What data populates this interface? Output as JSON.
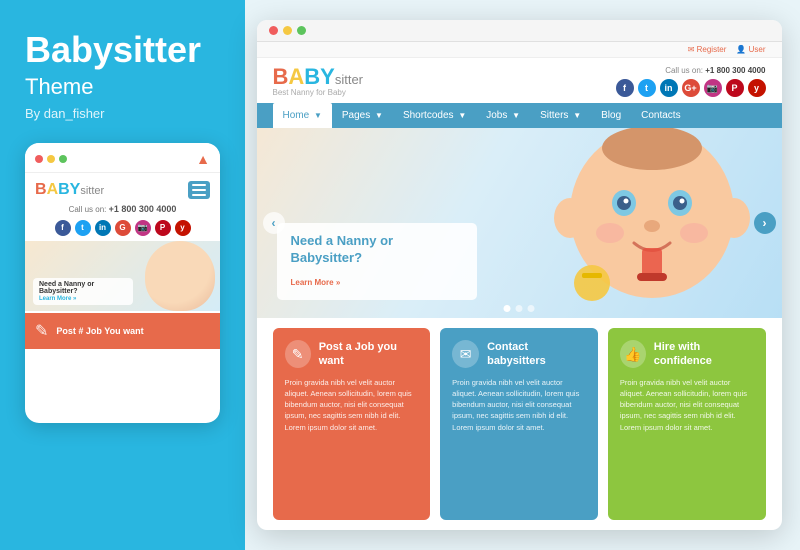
{
  "left": {
    "title": "Babysitter",
    "subtitle": "Theme",
    "author": "By dan_fisher",
    "mobile": {
      "logo_B": "B",
      "logo_A": "A",
      "logo_BY": "BY",
      "logo_sitter": "sitter",
      "callus_label": "Call us on:",
      "callus_number": "+1 800 300 4000",
      "hero_headline": "Need a Nanny or Babysitter?",
      "hero_learnmore": "Learn More »",
      "card_text": "Post # Job You want"
    }
  },
  "desktop": {
    "topbar_title": "···",
    "header_top_links": [
      "Register",
      "User"
    ],
    "logo_B": "B",
    "logo_A": "A",
    "logo_BY": "BY",
    "logo_sitter": "sitter",
    "logo_tagline": "Best Nanny for Baby",
    "callus_label": "Call us on:",
    "callus_number": "+1 800 300 4000",
    "nav_items": [
      "Home",
      "Pages",
      "Shortcodes",
      "Jobs",
      "Sitters",
      "Blog",
      "Contacts"
    ],
    "hero_headline": "Need a Nanny or Babysitter?",
    "hero_learnmore": "Learn More »",
    "feature_cards": [
      {
        "icon": "✎",
        "title": "Post a Job you want",
        "body": "Proin gravida nibh vel velit auctor aliquet. Aenean sollicitudin, lorem quis bibendum auctor, nisi elit consequat ipsum, nec sagittis sem nibh id elit. Lorem ipsum dolor sit amet."
      },
      {
        "icon": "✉",
        "title": "Contact babysitters",
        "body": "Proin gravida nibh vel velit auctor aliquet. Aenean sollicitudin, lorem quis bibendum auctor, nisi elit consequat ipsum, nec sagittis sem nibh id elit. Lorem ipsum dolor sit amet."
      },
      {
        "icon": "👍",
        "title": "Hire with confidence",
        "body": "Proin gravida nibh vel velit auctor aliquet. Aenean sollicitudin, lorem quis bibendum auctor, nisi elit consequat ipsum, nec sagittis sem nibh id elit. Lorem ipsum dolor sit amet."
      }
    ]
  },
  "social_colors": {
    "facebook": "#3b5998",
    "twitter": "#1da1f2",
    "linkedin": "#0077b5",
    "google": "#dd4b39",
    "instagram": "#c13584",
    "pinterest": "#bd081c",
    "yelp": "#c41200"
  }
}
